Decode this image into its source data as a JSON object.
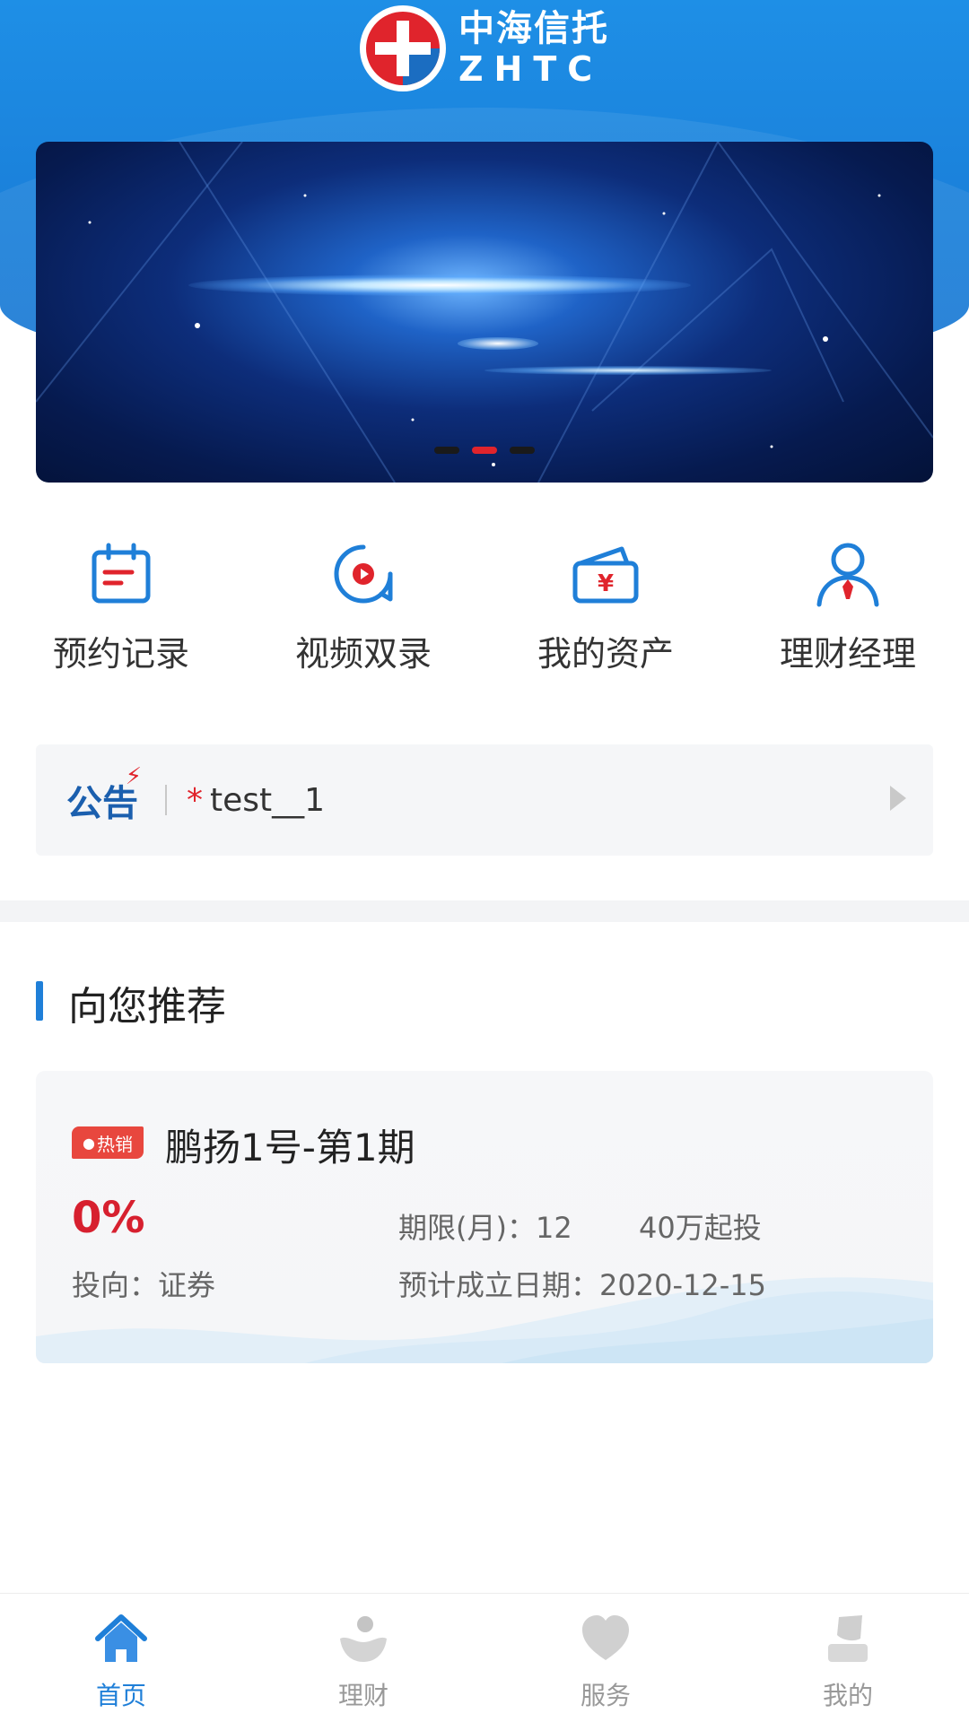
{
  "header": {
    "logo_cn": "中海信托",
    "logo_en": "ZHTC"
  },
  "banner": {
    "slide_count": 3,
    "active_index": 1
  },
  "quick_actions": [
    {
      "label": "预约记录",
      "icon": "calendar-icon"
    },
    {
      "label": "视频双录",
      "icon": "video-play-icon"
    },
    {
      "label": "我的资产",
      "icon": "wallet-yen-icon"
    },
    {
      "label": "理财经理",
      "icon": "manager-person-icon"
    }
  ],
  "notice": {
    "title": "公告",
    "marker": "*",
    "text": "test__1"
  },
  "recommend": {
    "section_title": "向您推荐",
    "product": {
      "tag": "热销",
      "name": "鹏扬1号-第1期",
      "rate": "0%",
      "term": "期限(月)：12",
      "min_investment": "40万起投",
      "direction": "投向：证券",
      "est_date": "预计成立日期：2020-12-15"
    }
  },
  "bottom_nav": [
    {
      "label": "首页",
      "icon": "home-icon",
      "active": true
    },
    {
      "label": "理财",
      "icon": "finance-icon",
      "active": false
    },
    {
      "label": "服务",
      "icon": "heart-hand-icon",
      "active": false
    },
    {
      "label": "我的",
      "icon": "profile-icon",
      "active": false
    }
  ],
  "colors": {
    "brand_blue": "#1f7fd8",
    "brand_red": "#e0242c",
    "header_blue": "#1a7fd9"
  }
}
